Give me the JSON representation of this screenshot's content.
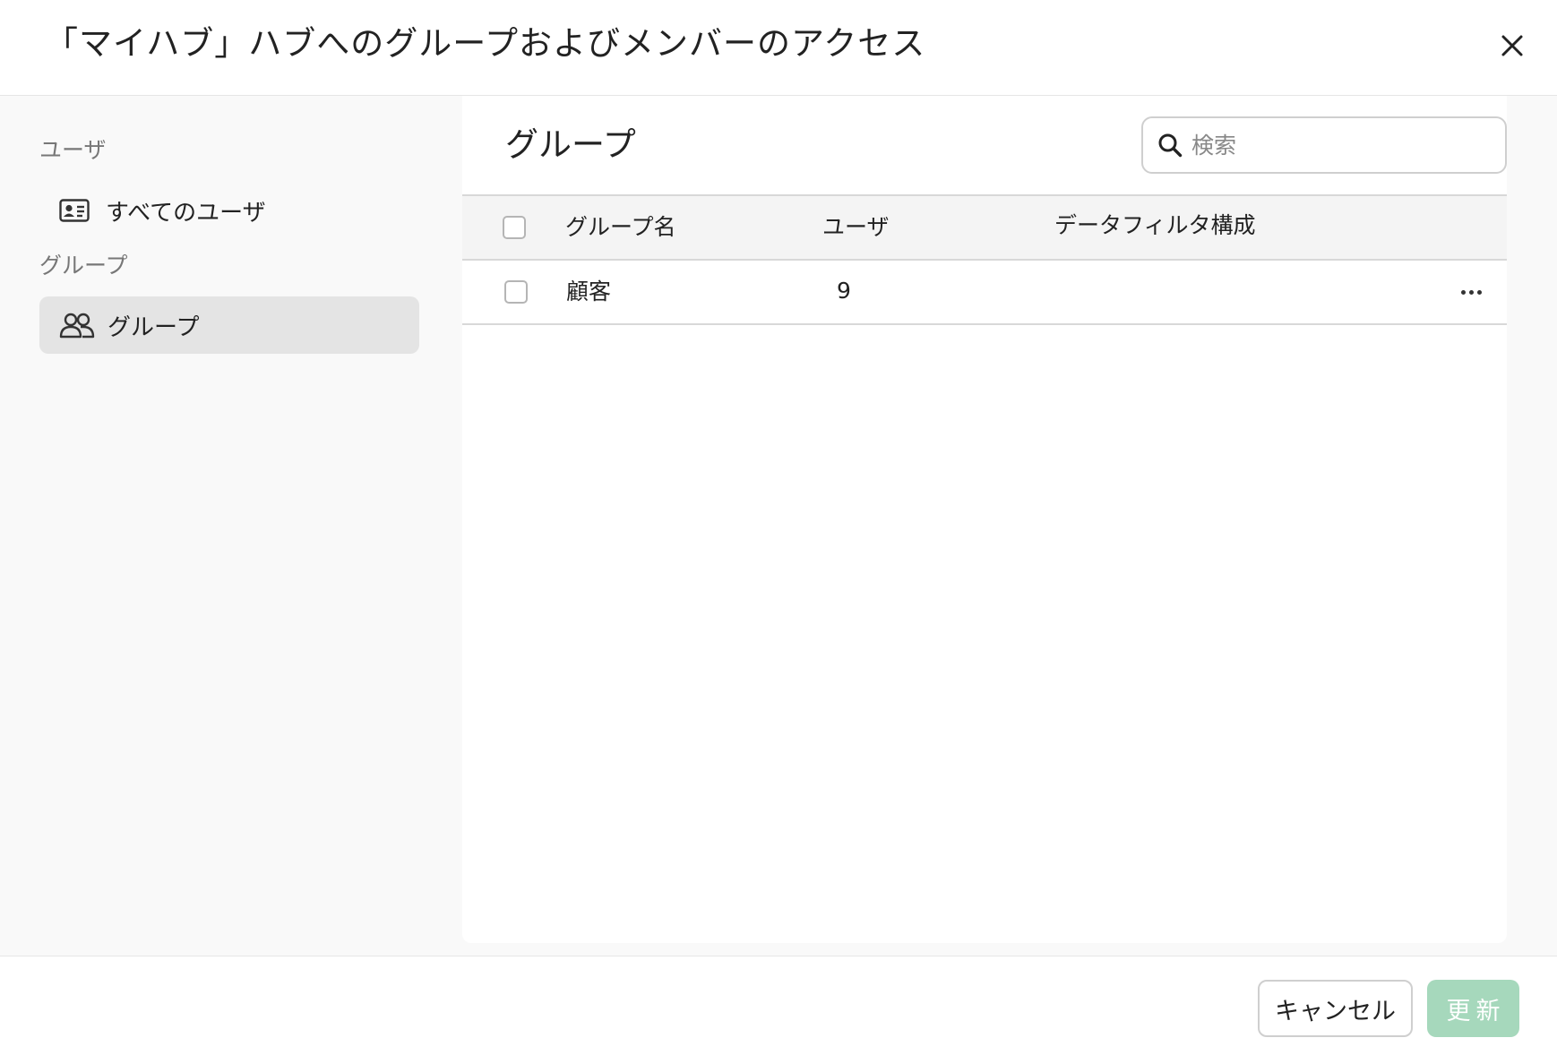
{
  "dialog": {
    "title": "「マイハブ」ハブへのグループおよびメンバーのアクセス",
    "close_icon": "close-icon"
  },
  "sidebar": {
    "sections": [
      {
        "label": "ユーザ",
        "items": [
          {
            "label": "すべてのユーザ",
            "icon": "id-card-icon",
            "active": false
          }
        ]
      },
      {
        "label": "グループ",
        "items": [
          {
            "label": "グループ",
            "icon": "users-icon",
            "active": true
          }
        ]
      }
    ]
  },
  "main": {
    "title": "グループ",
    "search": {
      "placeholder": "検索",
      "value": "",
      "icon": "search-icon"
    },
    "table": {
      "columns": [
        "グループ名",
        "ユーザ",
        "データフィルタ構成"
      ],
      "rows": [
        {
          "name": "顧客",
          "users": "9",
          "data_filter": ""
        }
      ]
    }
  },
  "footer": {
    "cancel_label": "キャンセル",
    "update_label": "更新",
    "update_enabled": false
  },
  "colors": {
    "accent_disabled": "#a6d8bc",
    "sidebar_active": "#e4e4e4",
    "sidebar_bg": "#f9f9f9"
  }
}
